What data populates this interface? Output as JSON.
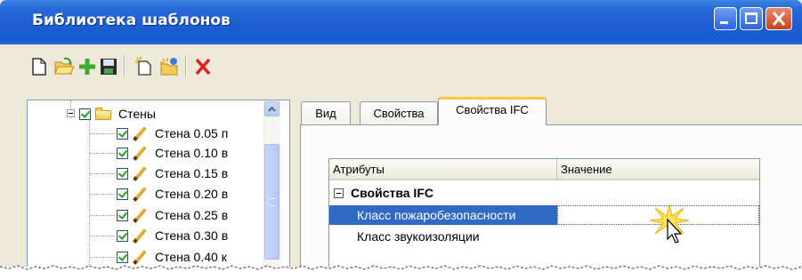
{
  "window": {
    "title": "Библиотека шаблонов",
    "controls": [
      "minimize-icon",
      "maximize-icon",
      "close-icon"
    ]
  },
  "toolbar": {
    "buttons": [
      "new-file-icon",
      "open-folder-icon",
      "add-icon",
      "save-icon",
      "new-template-icon",
      "new-folder-icon",
      "delete-icon"
    ]
  },
  "tree": {
    "folder": {
      "label": "Стены",
      "checked": true,
      "expanded": true
    },
    "items": [
      {
        "label": "Стена 0.05 п",
        "checked": true
      },
      {
        "label": "Стена 0.10 в",
        "checked": true
      },
      {
        "label": "Стена 0.15 в",
        "checked": true
      },
      {
        "label": "Стена 0.20 в",
        "checked": true
      },
      {
        "label": "Стена 0.25 в",
        "checked": true
      },
      {
        "label": "Стена 0.30 в",
        "checked": true
      },
      {
        "label": "Стена 0.40 к",
        "checked": true
      }
    ]
  },
  "tabs": [
    {
      "label": "Вид",
      "active": false
    },
    {
      "label": "Свойства",
      "active": false
    },
    {
      "label": "Свойства IFC",
      "active": true
    }
  ],
  "grid": {
    "columns": [
      "Атрибуты",
      "Значение"
    ],
    "category": "Свойства IFC",
    "rows": [
      {
        "name": "Класс пожаробезопасности",
        "value": "",
        "selected": true
      },
      {
        "name": "Класс звукоизоляции",
        "value": "",
        "selected": false
      }
    ]
  },
  "colors": {
    "titlebar": "#1c5ed2",
    "selection": "#316ac5",
    "active_tab_accent": "#ffc83c",
    "close_button": "#c8401d"
  }
}
